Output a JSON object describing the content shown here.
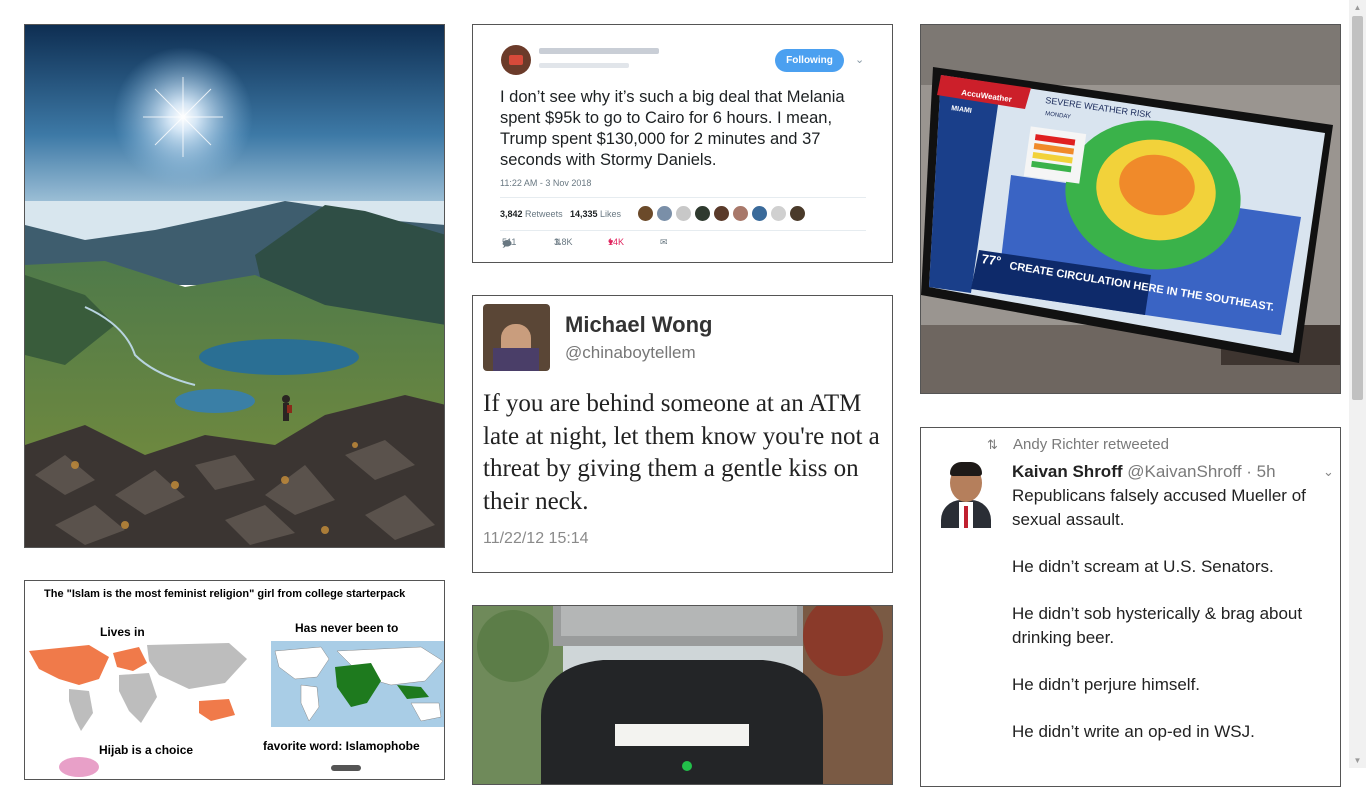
{
  "tweet1": {
    "follow_label": "Following",
    "text": "I don’t see why it’s such a big deal that Melania spent $95k to go to Cairo for 6 hours. I mean, Trump spent $130,000 for 2 minutes and 37 seconds with Stormy Daniels.",
    "datetime": "11:22 AM - 3 Nov 2018",
    "retweets_count": "3,842",
    "retweets_label": "Retweets",
    "likes_count": "14,335",
    "likes_label": "Likes",
    "replies": "511",
    "retweets_short": "3.8K",
    "likes_short": "14K"
  },
  "tweet2": {
    "name": "Michael Wong",
    "handle": "@chinaboytellem",
    "text": "If you are behind someone at an ATM late at night, let them know you're not a threat by giving them a gentle kiss on their neck.",
    "datetime": "11/22/12 15:14"
  },
  "tweet3": {
    "retweeted_by": "Andy Richter retweeted",
    "name": "Kaivan Shroff",
    "handle": "@KaivanShroff",
    "age": "· 5h",
    "paragraphs": [
      "Republicans falsely accused Mueller of sexual assault.",
      "He didn’t scream at U.S. Senators.",
      "He didn’t sob hysterically & brag about drinking beer.",
      "He didn’t perjure himself.",
      "He didn’t write an op-ed in WSJ."
    ]
  },
  "weather": {
    "brand": "AccuWeather",
    "headline": "SEVERE WEATHER RISK",
    "day": "MONDAY",
    "city": "MIAMI",
    "temp": "77°",
    "ticker": "CREATE CIRCULATION HERE IN THE SOUTHEAST."
  },
  "starterpack": {
    "title": "The \"Islam is the most feminist religion\" girl from college starterpack",
    "lives_in": "Lives in",
    "never_been": "Has never been to",
    "hijab": "Hijab is a choice",
    "favorite_word": "favorite word: Islamophobe"
  },
  "colors": {
    "follow_blue": "#4ba0f0",
    "like_red": "#e0245e",
    "card_border": "#555555"
  },
  "icons": [
    "reply-icon",
    "retweet-icon",
    "heart-icon",
    "mail-icon",
    "chevron-down-icon"
  ]
}
